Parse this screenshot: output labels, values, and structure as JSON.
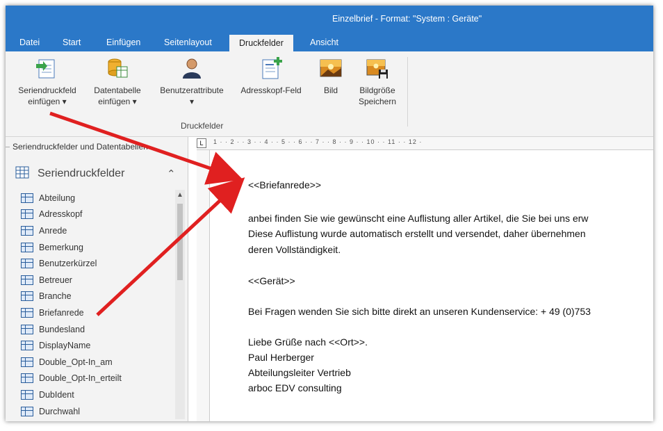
{
  "window": {
    "title": "Einzelbrief - Format: \"System : Geräte\""
  },
  "tabs": [
    "Datei",
    "Start",
    "Einfügen",
    "Seitenlayout",
    "Druckfelder",
    "Ansicht"
  ],
  "active_tab": "Druckfelder",
  "ribbon": {
    "buttons": [
      {
        "line1": "Seriendruckfeld",
        "line2": "einfügen ▾"
      },
      {
        "line1": "Datentabelle",
        "line2": "einfügen ▾"
      },
      {
        "line1": "Benutzerattribute",
        "line2": "▾"
      },
      {
        "line1": "Adresskopf-Feld",
        "line2": ""
      },
      {
        "line1": "Bild",
        "line2": ""
      },
      {
        "line1": "Bildgröße",
        "line2": "Speichern"
      }
    ],
    "group_label": "Druckfelder"
  },
  "left_panel": {
    "title": "Seriendruckfelder und Datentabellen",
    "section_header": "Seriendruckfelder",
    "fields": [
      "Abteilung",
      "Adresskopf",
      "Anrede",
      "Bemerkung",
      "Benutzerkürzel",
      "Betreuer",
      "Branche",
      "Briefanrede",
      "Bundesland",
      "DisplayName",
      "Double_Opt-In_am",
      "Double_Opt-In_erteilt",
      "DubIdent",
      "Durchwahl"
    ]
  },
  "ruler": {
    "text": "1 · · 2 · · 3 · · 4 · · 5 · · 6 · · 7 · · 8 · · 9 · · 10 · · 11 · · 12 ·"
  },
  "document": {
    "lines": [
      "<<Briefanrede>>",
      "anbei finden Sie wie gewünscht eine Auflistung aller Artikel, die Sie bei uns erw",
      "Diese Auflistung wurde automatisch erstellt und versendet, daher übernehmen",
      "deren Vollständigkeit.",
      "<<Gerät>>",
      "Bei Fragen wenden Sie sich bitte direkt an unseren Kundenservice: + 49 (0)753",
      "Liebe Grüße nach <<Ort>>.",
      "Paul Herberger",
      "Abteilungsleiter Vertrieb",
      "arboc EDV consulting"
    ]
  },
  "colors": {
    "accent": "#2b78c8",
    "annotation_arrow": "#e02020"
  }
}
